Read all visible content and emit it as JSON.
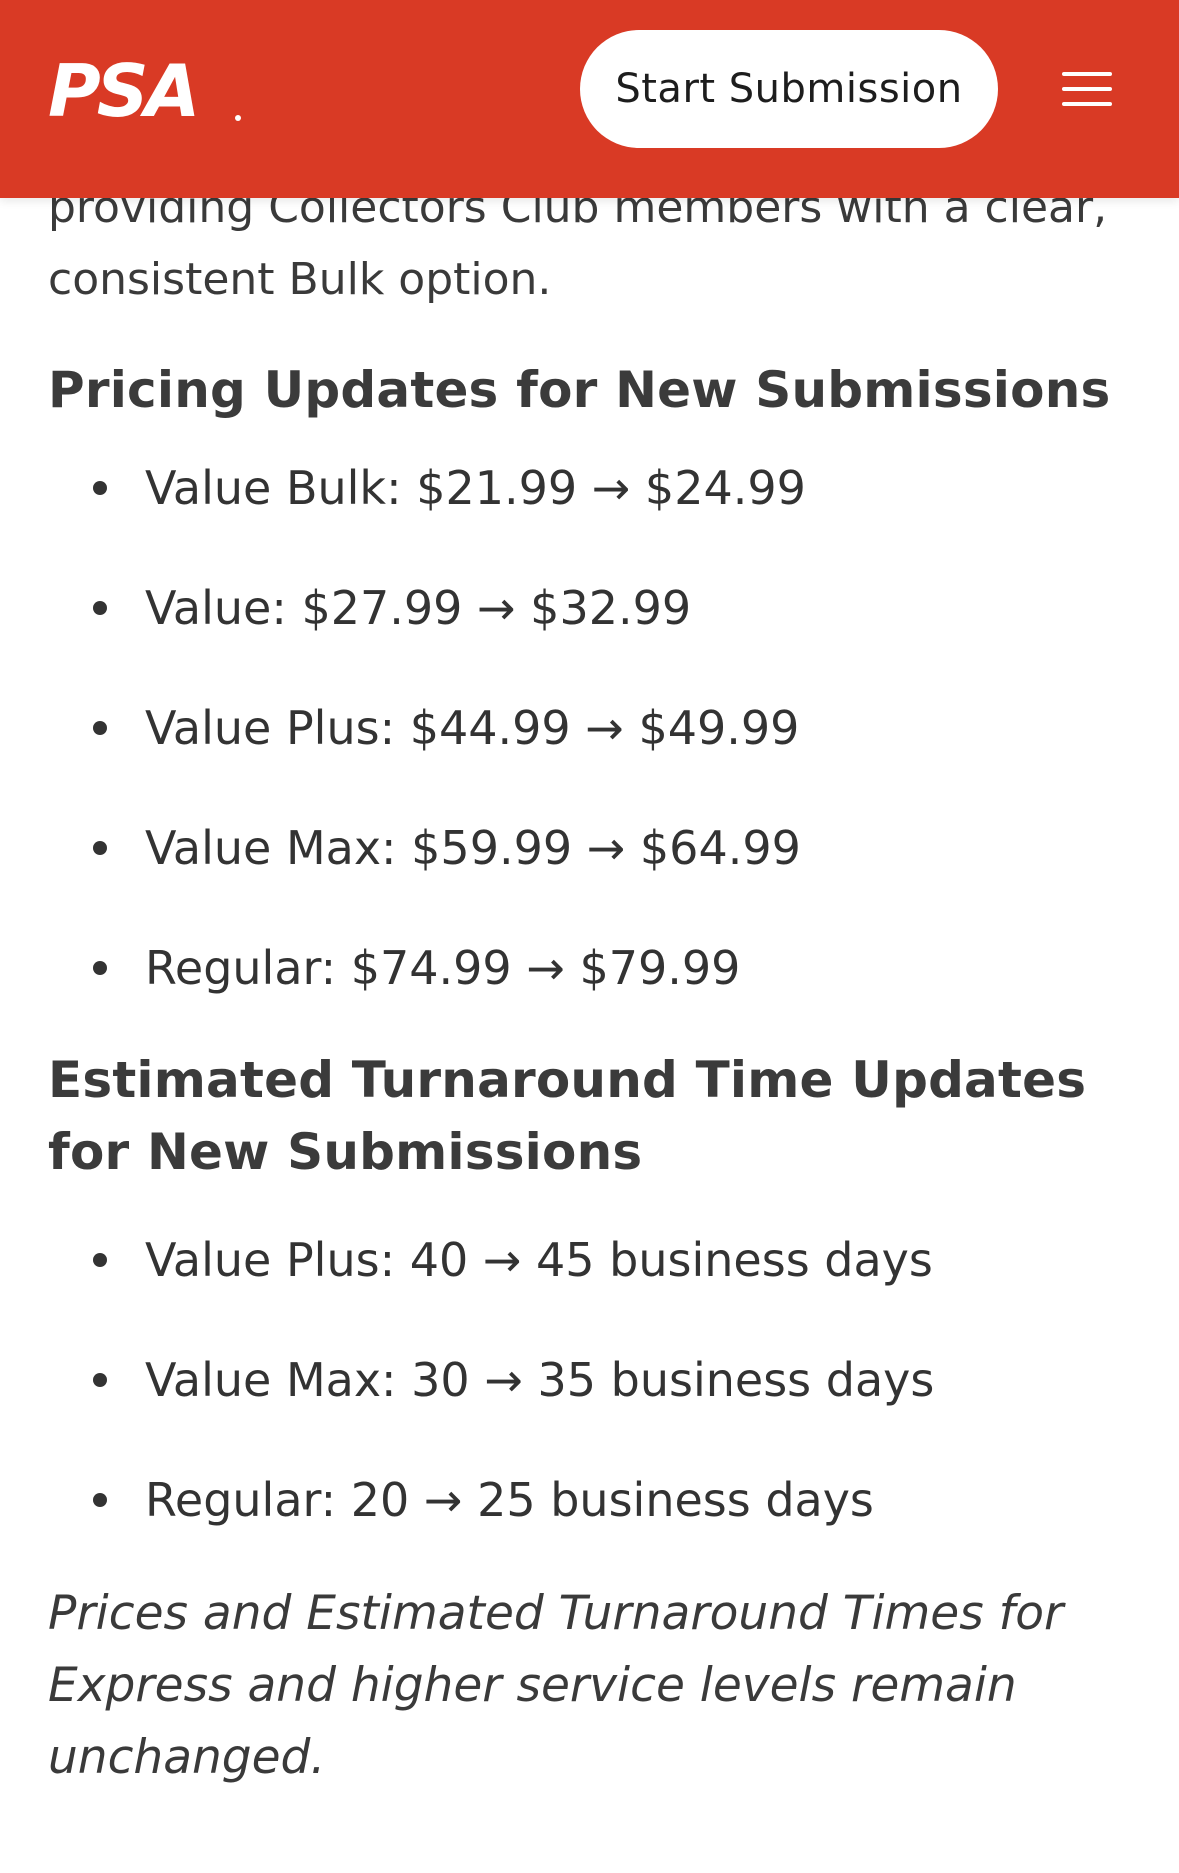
{
  "header": {
    "logo_text": "PSA",
    "start_button_label": "Start Submission",
    "brand_color": "#d93a25"
  },
  "article": {
    "intro": "providing Collectors Club members with a clear, consistent Bulk option.",
    "pricing_heading": "Pricing Updates for New Submissions",
    "pricing_items": [
      "Value Bulk: $21.99 → $24.99",
      "Value: $27.99 → $32.99",
      "Value Plus: $44.99 → $49.99",
      "Value Max: $59.99 → $64.99",
      "Regular: $74.99 → $79.99"
    ],
    "turnaround_heading": "Estimated Turnaround Time Updates for New Submissions",
    "turnaround_items": [
      "Value Plus: 40 → 45 business days",
      "Value Max: 30 → 35 business days",
      "Regular: 20 → 25 business days"
    ],
    "note": "Prices and Estimated Turnaround Times for Express and higher service levels remain unchanged."
  },
  "icons": {
    "menu": "hamburger-menu-icon",
    "bullet": "bullet-dot"
  }
}
